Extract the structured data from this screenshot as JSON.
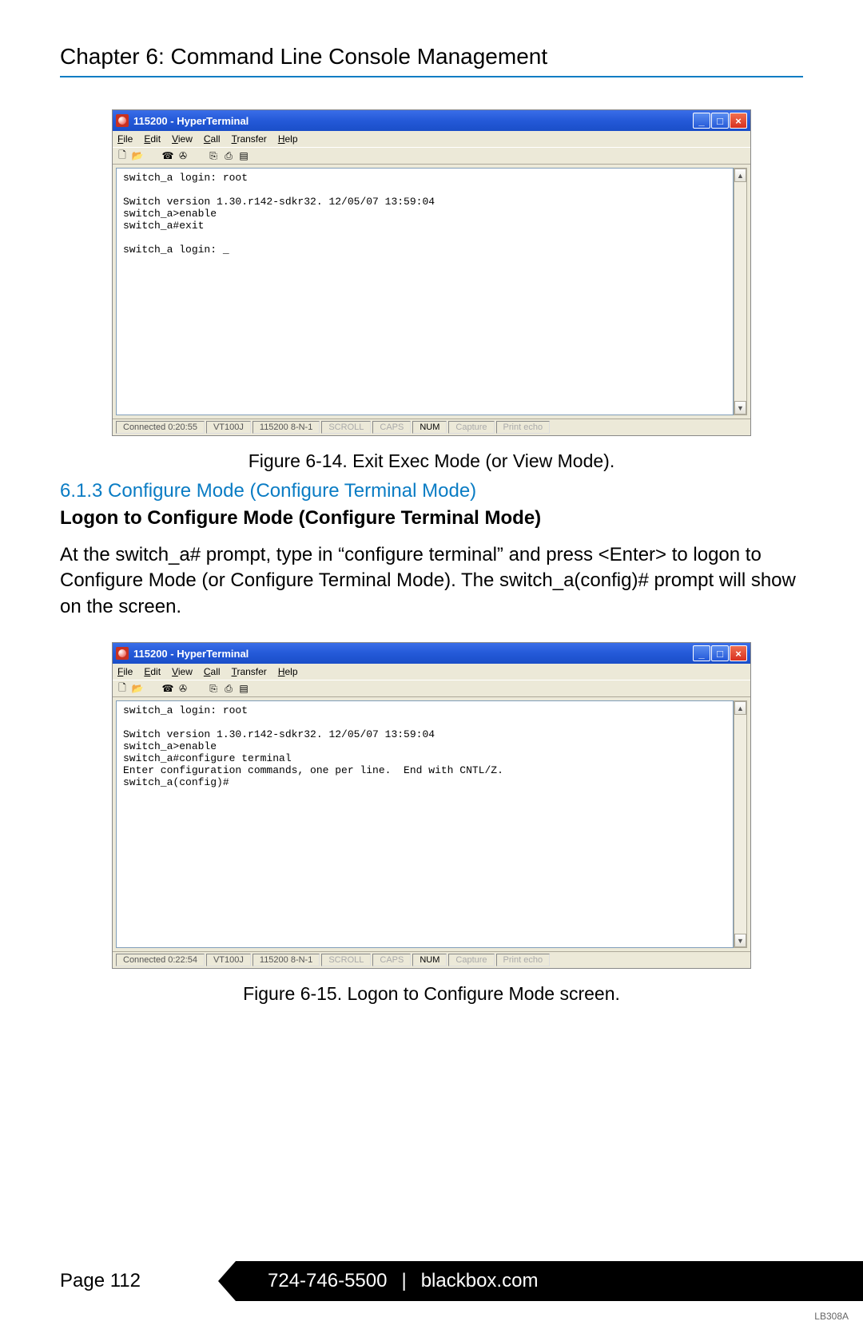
{
  "chapter_title": "Chapter 6: Command Line Console Management",
  "window1": {
    "title": "115200 - HyperTerminal",
    "menu": [
      "File",
      "Edit",
      "View",
      "Call",
      "Transfer",
      "Help"
    ],
    "terminal_text": "switch_a login: root\n\nSwitch version 1.30.r142-sdkr32. 12/05/07 13:59:04\nswitch_a>enable\nswitch_a#exit\n\nswitch_a login: _",
    "status": {
      "connected": "Connected 0:20:55",
      "term": "VT100J",
      "conn": "115200 8-N-1",
      "scroll": "SCROLL",
      "caps": "CAPS",
      "num": "NUM",
      "capture": "Capture",
      "print": "Print echo"
    }
  },
  "caption1": "Figure 6-14. Exit Exec Mode (or View Mode).",
  "section_head": "6.1.3 Configure Mode (Configure Terminal Mode)",
  "sub_head": "Logon to Configure Mode (Configure Terminal Mode)",
  "body_text": "At the switch_a# prompt, type in “configure terminal” and press <Enter> to logon to Configure Mode (or Configure Terminal Mode). The switch_a(config)# prompt will show on the screen.",
  "window2": {
    "title": "115200 - HyperTerminal",
    "menu": [
      "File",
      "Edit",
      "View",
      "Call",
      "Transfer",
      "Help"
    ],
    "terminal_text": "switch_a login: root\n\nSwitch version 1.30.r142-sdkr32. 12/05/07 13:59:04\nswitch_a>enable\nswitch_a#configure terminal\nEnter configuration commands, one per line.  End with CNTL/Z.\nswitch_a(config)#",
    "status": {
      "connected": "Connected 0:22:54",
      "term": "VT100J",
      "conn": "115200 8-N-1",
      "scroll": "SCROLL",
      "caps": "CAPS",
      "num": "NUM",
      "capture": "Capture",
      "print": "Print echo"
    }
  },
  "caption2": "Figure 6-15. Logon to Configure Mode screen.",
  "footer": {
    "page": "Page 112",
    "phone": "724-746-5500",
    "sep": "|",
    "site": "blackbox.com",
    "code": "LB308A"
  }
}
